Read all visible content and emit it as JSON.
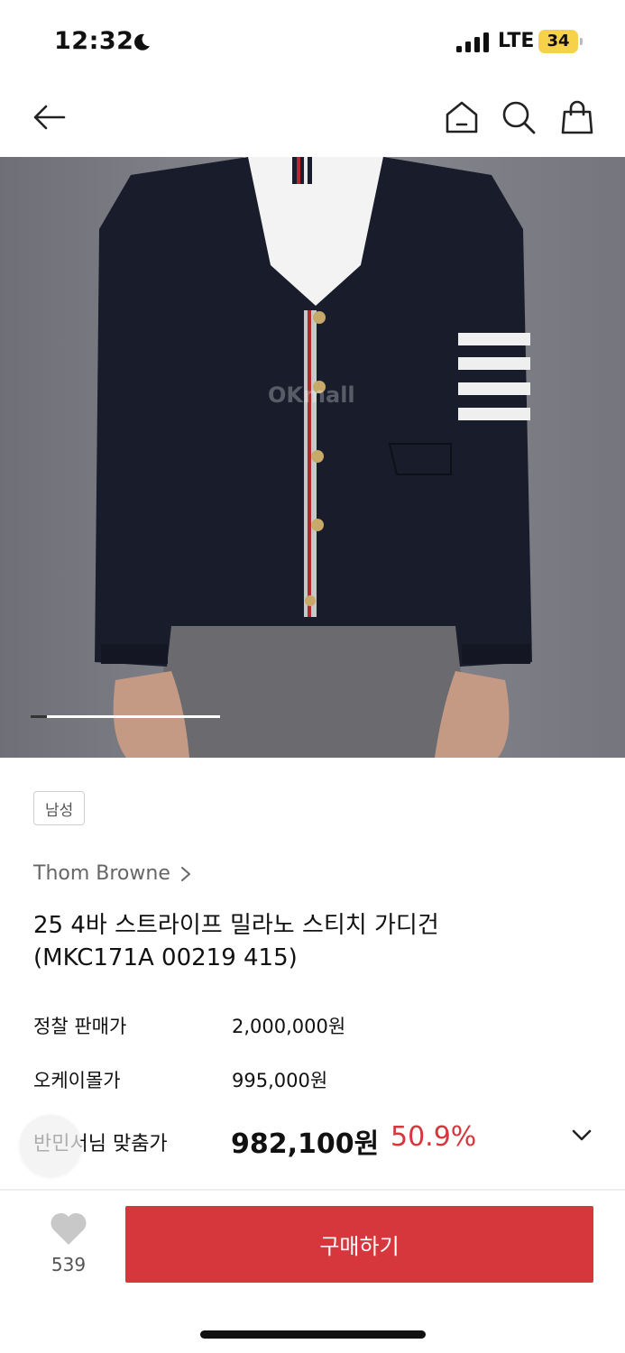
{
  "status": {
    "time": "12:32",
    "network": "LTE",
    "battery": "34"
  },
  "nav": {
    "back_icon": "back-arrow-icon",
    "home_icon": "home-icon",
    "search_icon": "search-icon",
    "bag_icon": "shopping-bag-icon"
  },
  "image": {
    "watermark": "OKmall",
    "carousel_position": 0.08
  },
  "product": {
    "gender": "남성",
    "brand": "Thom Browne",
    "title_line1": "25 4바 스트라이프 밀라노 스티치 가디건",
    "title_line2": "(MKC171A 00219 415)"
  },
  "prices": {
    "retail_label": "정찰 판매가",
    "retail_value": "2,000,000원",
    "okmall_label": "오케이몰가",
    "okmall_value": "995,000원",
    "member_label": "반민서님 맞춤가",
    "member_value": "982,100원",
    "discount": "50.9%"
  },
  "bottom": {
    "like_count": "539",
    "buy_label": "구매하기"
  },
  "colors": {
    "accent": "#d6373c",
    "image_bg": "#7e7e86"
  }
}
